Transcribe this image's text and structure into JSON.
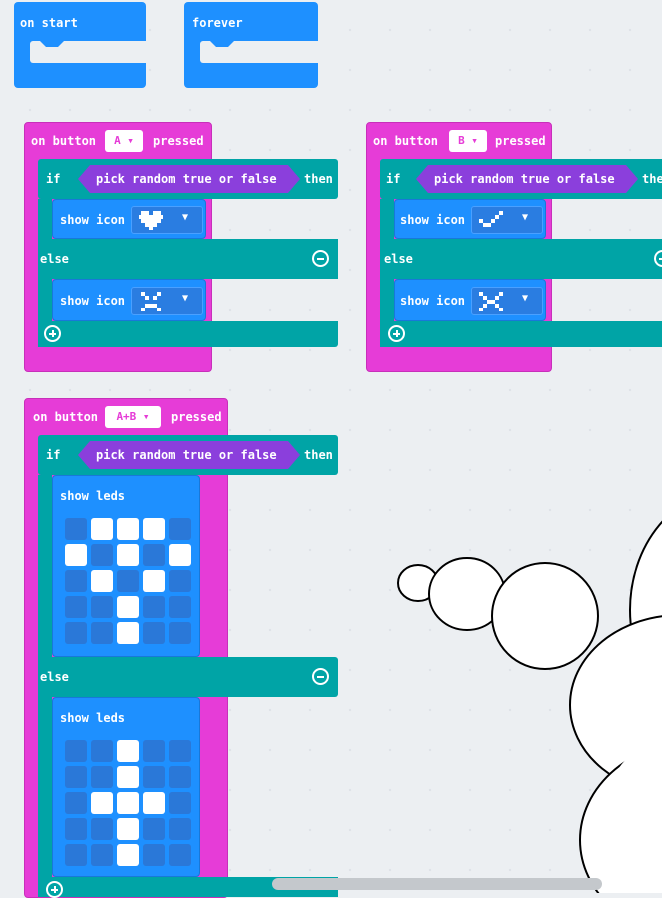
{
  "blocks": {
    "on_start": {
      "label": "on start"
    },
    "forever": {
      "label": "forever"
    },
    "button_a": {
      "prefix": "on button",
      "button": "A ▾",
      "suffix": "pressed",
      "if": "if",
      "condition": "pick random true or false",
      "then": "then",
      "show_icon_1": "show icon",
      "else": "else",
      "show_icon_2": "show icon"
    },
    "button_b": {
      "prefix": "on button",
      "button": "B ▾",
      "suffix": "pressed",
      "if": "if",
      "condition": "pick random true or false",
      "then": "the",
      "show_icon_1": "show icon",
      "else": "else",
      "show_icon_2": "show icon"
    },
    "button_ab": {
      "prefix": "on button",
      "button": "A+B ▾",
      "suffix": "pressed",
      "if": "if",
      "condition": "pick random true or false",
      "then": "then",
      "show_leds_1": "show leds",
      "else": "else",
      "show_leds_2": "show leds",
      "leds_1": [
        [
          0,
          1,
          1,
          1,
          0
        ],
        [
          1,
          0,
          1,
          0,
          1
        ],
        [
          0,
          1,
          0,
          1,
          0
        ],
        [
          0,
          0,
          1,
          0,
          0
        ],
        [
          0,
          0,
          1,
          0,
          0
        ]
      ],
      "leds_2": [
        [
          0,
          0,
          1,
          0,
          0
        ],
        [
          0,
          0,
          1,
          0,
          0
        ],
        [
          0,
          1,
          1,
          1,
          0
        ],
        [
          0,
          0,
          1,
          0,
          0
        ],
        [
          0,
          0,
          1,
          0,
          0
        ]
      ]
    }
  },
  "colors": {
    "event": "#e63cd7",
    "logic": "#00a4a6",
    "basic": "#1e90ff",
    "boolean": "#8b3fdc",
    "workspace": "#eceff2"
  }
}
